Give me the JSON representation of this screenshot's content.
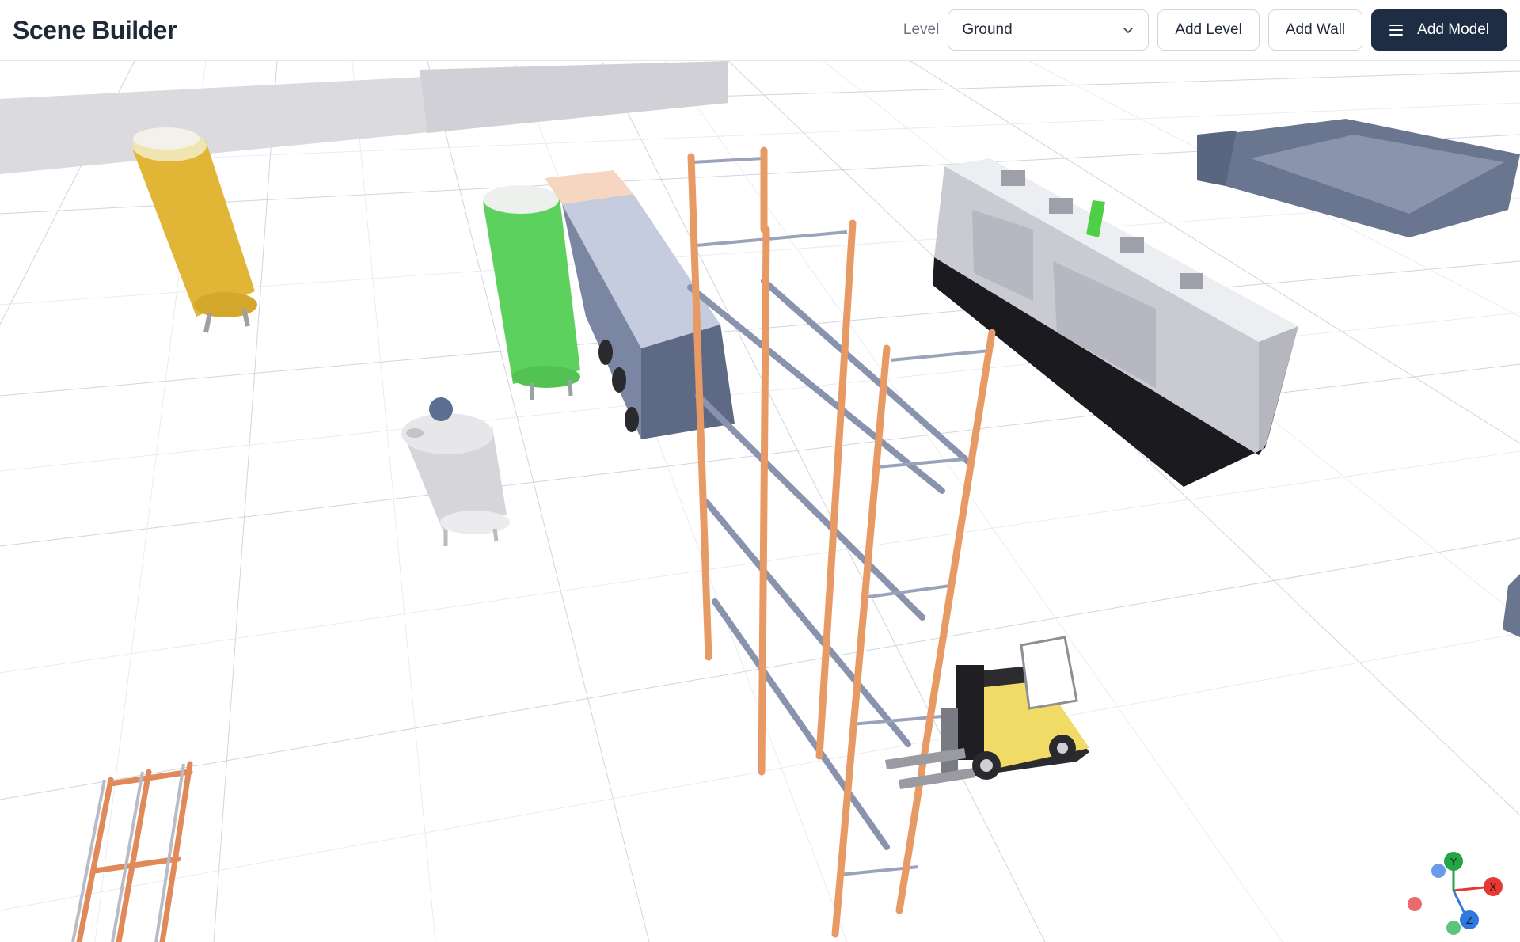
{
  "app": {
    "title": "Scene Builder"
  },
  "toolbar": {
    "level_label": "Level",
    "level_selected": "Ground",
    "add_level_label": "Add Level",
    "add_wall_label": "Add Wall",
    "add_model_label": "Add Model",
    "add_model_icon": "menu-icon"
  },
  "gizmo": {
    "x_label": "X",
    "y_label": "Y",
    "z_label": "Z"
  },
  "colors": {
    "primary_button": "#1f2d44",
    "axis_x": "#e53935",
    "axis_y": "#22a447",
    "axis_z": "#2f78e0",
    "rack_upright": "#e89a64",
    "rack_beam": "#8a93ad"
  }
}
